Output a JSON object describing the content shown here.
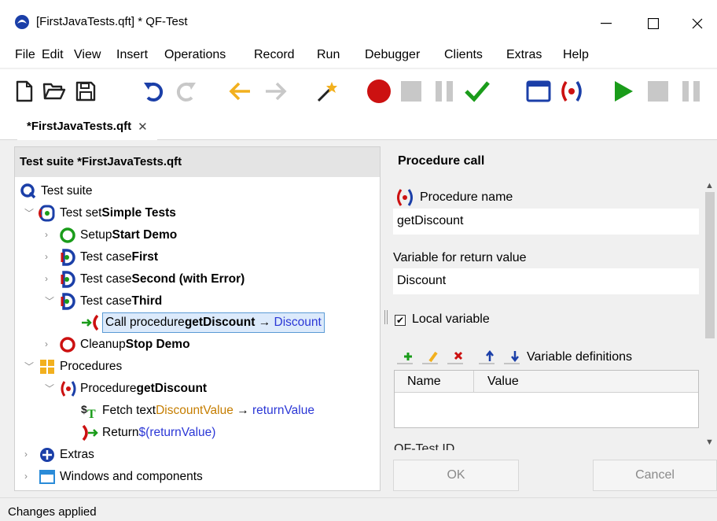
{
  "window": {
    "title": "[FirstJavaTests.qft] * QF-Test",
    "minimize_glyph": "—",
    "maximize_glyph": "☐",
    "close_glyph": "✕"
  },
  "menu": [
    "File",
    "Edit",
    "View",
    "Insert",
    "Operations",
    "Record",
    "Run",
    "Debugger",
    "Clients",
    "Extras",
    "Help"
  ],
  "toolbar": {
    "icons": [
      "new-file-icon",
      "open-folder-icon",
      "save-icon",
      "undo-icon",
      "redo-icon",
      "back-arrow-icon",
      "forward-arrow-icon",
      "wand-icon",
      "record-icon",
      "stop-record-icon",
      "pause-record-icon",
      "check-icon",
      "window-icon",
      "procedure-icon",
      "play-icon",
      "stop-icon",
      "pause-icon"
    ],
    "colors": {
      "blue": "#1b3fa8",
      "orange": "#f2b01e",
      "red": "#cc1111",
      "green": "#1a9c1a",
      "gray": "#c8c8c8"
    }
  },
  "tab": {
    "label": "*FirstJavaTests.qft",
    "close": "✕"
  },
  "tree": {
    "header": "Test suite *FirstJavaTests.qft",
    "nodes": [
      {
        "prefix": "Test suite",
        "name": ""
      },
      {
        "prefix": "Test set ",
        "name": "Simple Tests"
      },
      {
        "prefix": "Setup ",
        "name": "Start Demo"
      },
      {
        "prefix": "Test case ",
        "name": "First"
      },
      {
        "prefix": "Test case ",
        "name": "Second (with Error)"
      },
      {
        "prefix": "Test case ",
        "name": "Third"
      },
      {
        "prefix": "Call procedure ",
        "name": "getDiscount",
        "arrow": "→",
        "target": "Discount"
      },
      {
        "prefix": "Cleanup ",
        "name": "Stop Demo"
      },
      {
        "prefix": "Procedures",
        "name": ""
      },
      {
        "prefix": "Procedure ",
        "name": "getDiscount"
      },
      {
        "prefix": "Fetch text ",
        "component": "DiscountValue",
        "arrow": "→",
        "target": "returnValue"
      },
      {
        "prefix": "Return ",
        "target": "$(returnValue)"
      },
      {
        "prefix": "Extras",
        "name": ""
      },
      {
        "prefix": "Windows and components",
        "name": ""
      }
    ]
  },
  "details": {
    "title": "Procedure call",
    "procedure_name_label": "Procedure name",
    "procedure_name_value": "getDiscount",
    "return_var_label": "Variable for return value",
    "return_var_value": "Discount",
    "local_variable_label": "Local variable",
    "local_variable_checked": true,
    "check_glyph": "✔",
    "var_defs_label": "Variable definitions",
    "var_columns": [
      "Name",
      "Value"
    ],
    "qft_id_label": "QF-Test ID",
    "ok_label": "OK",
    "cancel_label": "Cancel"
  },
  "status": {
    "text": "Changes applied"
  }
}
